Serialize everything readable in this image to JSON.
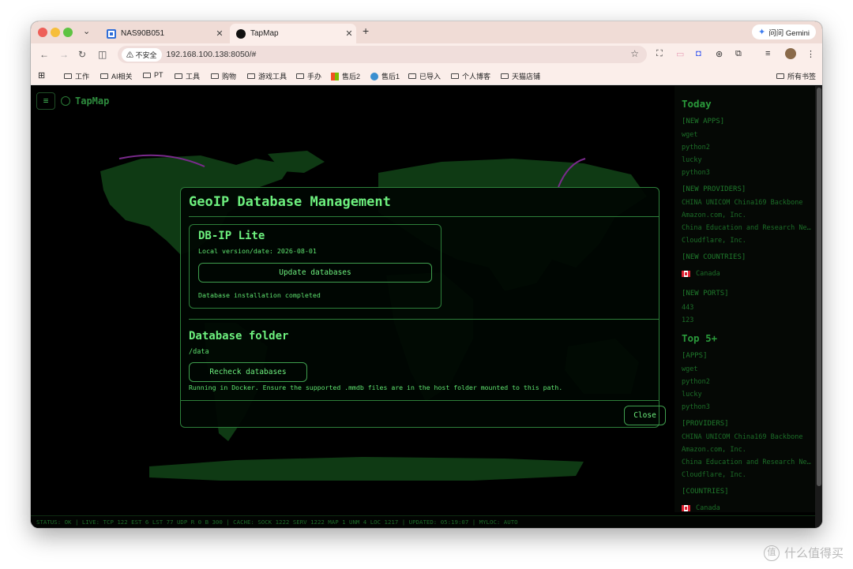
{
  "browser": {
    "tabs": [
      {
        "label": "NAS90B051",
        "active": false
      },
      {
        "label": "TapMap",
        "active": true
      }
    ],
    "gemini_label": "问问 Gemini",
    "security_label": "不安全",
    "url": "192.168.100.138:8050/#",
    "bookmarks": [
      "工作",
      "AI相关",
      "PT",
      "工具",
      "购物",
      "游戏工具",
      "手办",
      "售后2",
      "售后1",
      "已导入",
      "个人博客",
      "天猫店铺"
    ],
    "all_bookmarks_label": "所有书签"
  },
  "app": {
    "menu_glyph": "≡",
    "title": "TapMap"
  },
  "sidebar": {
    "today_title": "Today",
    "new_apps_label": "[NEW APPS]",
    "new_apps": [
      "wget",
      "python2",
      "lucky",
      "python3"
    ],
    "new_providers_label": "[NEW PROVIDERS]",
    "new_providers": [
      "CHINA UNICOM China169 Backbone",
      "Amazon.com, Inc.",
      "China Education and Research Network",
      "Cloudflare, Inc."
    ],
    "new_countries_label": "[NEW COUNTRIES]",
    "new_countries": [
      "Canada"
    ],
    "new_ports_label": "[NEW PORTS]",
    "new_ports": [
      "443",
      "123"
    ],
    "top_title": "Top 5+",
    "apps_label": "[APPS]",
    "apps": [
      "wget",
      "python2",
      "lucky",
      "python3"
    ],
    "providers_label": "[PROVIDERS]",
    "providers": [
      "CHINA UNICOM China169 Backbone",
      "Amazon.com, Inc.",
      "China Education and Research Network",
      "Cloudflare, Inc."
    ],
    "countries_label": "[COUNTRIES]",
    "countries": [
      "Canada"
    ]
  },
  "status_bar": "STATUS: OK | LIVE: TCP 122 EST 6 LST 77 UDP R 0 B 300 | CACHE: SOCK 1222 SERV 1222 MAP 1 UNM 4 LOC 1217 | UPDATED: 05:19:07 | MYLOC: AUTO",
  "modal": {
    "title": "GeoIP Database Management",
    "db_name": "DB-IP Lite",
    "local_version": "Local version/date: 2026-08-01",
    "update_button": "Update databases",
    "install_status": "Database installation completed",
    "folder_title": "Database folder",
    "folder_path": "/data",
    "recheck_button": "Recheck databases",
    "folder_note": "Running in Docker. Ensure the supported .mmdb files are in the host folder mounted to this path.",
    "close_button": "Close"
  },
  "colors": {
    "accent_green": "#6df07e",
    "map_land": "#0f3a14",
    "arc_purple": "#7a2a8c"
  },
  "watermark": "什么值得买",
  "watermark_badge": "值"
}
